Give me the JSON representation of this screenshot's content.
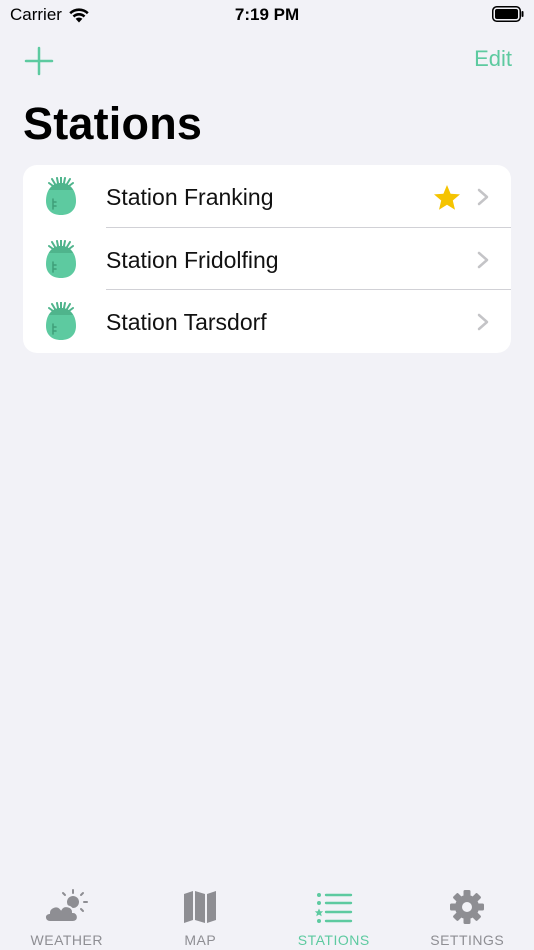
{
  "status_bar": {
    "carrier": "Carrier",
    "time": "7:19 PM"
  },
  "nav": {
    "add_icon": "plus-icon",
    "edit_label": "Edit"
  },
  "page": {
    "title": "Stations"
  },
  "stations": [
    {
      "name": "Station Franking",
      "favorite": true,
      "icon": "station-sensor-icon"
    },
    {
      "name": "Station Fridolfing",
      "favorite": false,
      "icon": "station-sensor-icon"
    },
    {
      "name": "Station Tarsdorf",
      "favorite": false,
      "icon": "station-sensor-icon"
    }
  ],
  "tabs": [
    {
      "label": "WEATHER",
      "icon": "weather-icon",
      "active": false
    },
    {
      "label": "MAP",
      "icon": "map-icon",
      "active": false
    },
    {
      "label": "STATIONS",
      "icon": "list-icon",
      "active": true
    },
    {
      "label": "SETTINGS",
      "icon": "gear-icon",
      "active": false
    }
  ],
  "colors": {
    "accent": "#5dcaa0",
    "star": "#f5c400",
    "background": "#f2f2f7",
    "inactive": "#8e8e93"
  }
}
